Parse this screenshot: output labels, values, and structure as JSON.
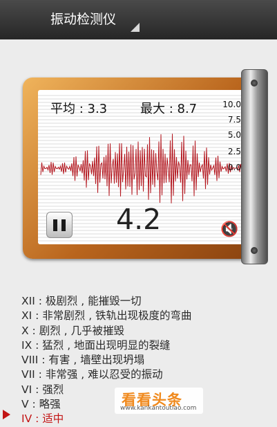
{
  "app": {
    "title": "振动检测仪"
  },
  "meter": {
    "average": "平均 : 3.3",
    "max": "最大 : 8.7",
    "current": "4.2",
    "scale": [
      "10.0",
      "7.5",
      "5.0",
      "2.5",
      "0.0"
    ]
  },
  "intensity_levels": [
    "XII : 极剧烈 , 能摧毁一切",
    "XI : 非常剧烈 , 铁轨出现极度的弯曲",
    "X : 剧烈 , 几乎被摧毁",
    "IX : 猛烈 , 地面出现明显的裂缝",
    "VIII : 有害 , 墙壁出现坍塌",
    "VII : 非常强 , 难以忍受的振动",
    "VI : 强烈",
    "V : 略强",
    "IV : 适中"
  ],
  "current_level_index": 8,
  "watermark": {
    "title": "看看头条",
    "url": "www.kankantoutiao.com"
  },
  "icons": {
    "pause": "pause-icon",
    "mute": "speaker-muted-icon",
    "pointer": "triangle-right-icon"
  },
  "colors": {
    "waveform": "#b3161e",
    "frame": "#c97a2a",
    "current_level": "#c21414"
  }
}
